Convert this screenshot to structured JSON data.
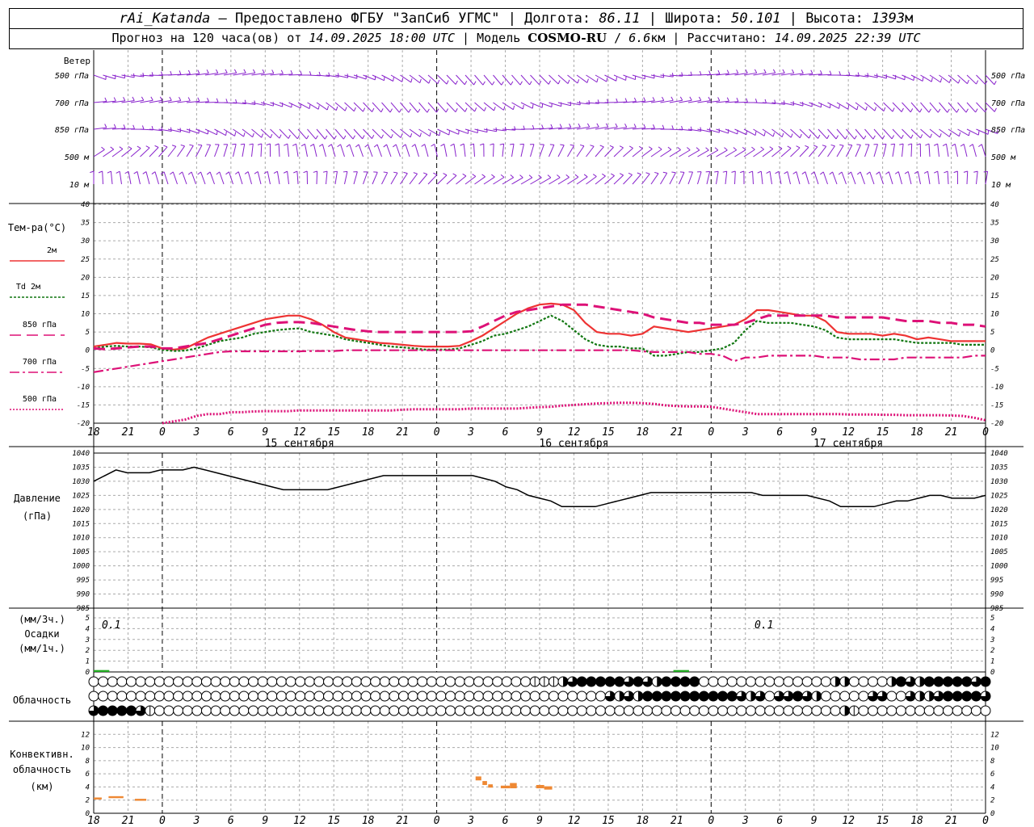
{
  "header": {
    "station": "rAi_Katanda",
    "provider": "Предоставлено ФГБУ \"ЗапСиб УГМС\"",
    "lon_label": "Долгота:",
    "lon": "86.11",
    "lat_label": "Широта:",
    "lat": "50.101",
    "alt_label": "Высота:",
    "alt": "1393",
    "alt_unit": "м",
    "forecast_label": "Прогноз на 120 часа(ов) от",
    "forecast_from": "14.09.2025 18:00 UTC",
    "model_label": "Модель",
    "model": "COSMO-RU",
    "resolution": "6.6",
    "res_unit": "км",
    "computed_label": "Рассчитано:",
    "computed": "14.09.2025 22:39 UTC"
  },
  "labels": {
    "wind": "Ветер",
    "wind_levels": [
      "500 гПа",
      "700 гПа",
      "850 гПа",
      "500 м",
      "10 м"
    ],
    "temp_title": "Тем-ра(°C)",
    "temp_legend": [
      "2м",
      "Td 2м",
      "850 гПа",
      "700 гПа",
      "500 гПа"
    ],
    "pressure": "Давление",
    "pressure_unit": "(гПа)",
    "precip_unit_top": "(мм/3ч.)",
    "precip": "Осадки",
    "precip_unit_bottom": "(мм/1ч.)",
    "cloud": "Облачность",
    "conv1": "Конвективн.",
    "conv2": "облачность",
    "conv3": "(км)",
    "day_labels": [
      "15 сентября",
      "16 сентября",
      "17 сентября"
    ],
    "precip_annotations": [
      "0.1",
      "0.1"
    ]
  },
  "colors": {
    "t2m": "#ee3333",
    "td2m": "#117711",
    "t850": "#dd1177",
    "t700": "#dd1177",
    "t500": "#dd1177",
    "pressure": "#000000",
    "wind": "#8822cc",
    "precip": "#22aa22",
    "conv": "#ee8833",
    "grid": "#aaaaaa"
  },
  "chart_data": [
    {
      "type": "line",
      "name": "temperature",
      "x_hours": [
        0,
        1,
        2,
        3,
        4,
        5,
        6,
        7,
        8,
        9,
        10,
        11,
        12,
        13,
        14,
        15,
        16,
        17,
        18,
        19,
        20,
        21,
        22,
        23,
        24,
        25,
        26,
        27,
        28,
        29,
        30,
        31,
        32,
        33,
        34,
        35,
        36,
        37,
        38,
        39,
        40,
        41,
        42,
        43,
        44,
        45,
        46,
        47,
        48,
        49,
        50,
        51,
        52,
        53,
        54,
        55,
        56,
        57,
        58,
        59,
        60,
        61,
        62,
        63,
        64,
        65,
        66,
        67,
        68,
        69,
        70,
        71,
        72,
        73,
        74,
        75,
        76,
        77,
        78
      ],
      "x_tick_labels": [
        "18",
        "21",
        "0",
        "3",
        "6",
        "9",
        "12",
        "15",
        "18",
        "21",
        "0",
        "3",
        "6",
        "9",
        "12",
        "15",
        "18",
        "21",
        "0",
        "3",
        "6",
        "9",
        "12",
        "15",
        "18",
        "21",
        "0"
      ],
      "ylim": [
        -20,
        40
      ],
      "yticks": [
        -20,
        -15,
        -10,
        -5,
        0,
        5,
        10,
        15,
        20,
        25,
        30,
        35,
        40
      ],
      "series": [
        {
          "name": "2м",
          "values": [
            1,
            1.5,
            2,
            1.8,
            1.8,
            1.6,
            0.5,
            0.2,
            0.5,
            2,
            3.5,
            4.5,
            5.5,
            6.5,
            7.5,
            8.5,
            9,
            9.5,
            9.5,
            8.5,
            7,
            5,
            3.5,
            3,
            2.5,
            2,
            1.8,
            1.5,
            1.2,
            1,
            1,
            1,
            1.2,
            2.5,
            4,
            6,
            8,
            10,
            11.5,
            12.5,
            12.8,
            12.5,
            11,
            7.5,
            5,
            4.5,
            4.5,
            4,
            4.5,
            6.5,
            6,
            5.5,
            5,
            5.5,
            6,
            6.5,
            7,
            8.5,
            11,
            11,
            10.5,
            10,
            9.5,
            9.5,
            8,
            5,
            4.5,
            4.5,
            4.5,
            4,
            4.5,
            4,
            3,
            3.5,
            3,
            2.5,
            2.5,
            2.5,
            2.5
          ]
        },
        {
          "name": "Td 2м",
          "values": [
            0.5,
            1,
            1.2,
            1,
            1,
            0.8,
            0.1,
            -0.2,
            -0.1,
            0.5,
            1.5,
            2.5,
            3,
            3.5,
            4.5,
            5,
            5.5,
            5.8,
            6,
            5,
            4.5,
            4,
            3,
            2.5,
            2,
            1.5,
            1,
            0.8,
            0.5,
            0.2,
            0.2,
            0.2,
            0.5,
            1.5,
            2.5,
            4,
            4.5,
            5.5,
            6.5,
            8,
            9.5,
            8,
            5.5,
            3,
            1.5,
            1,
            1,
            0.5,
            0.5,
            -1.5,
            -1.5,
            -1,
            -0.5,
            -0.5,
            0,
            0.5,
            2,
            5.5,
            8,
            7.5,
            7.5,
            7.5,
            7,
            6.5,
            5.5,
            3.5,
            3,
            3,
            3,
            3,
            3,
            2.5,
            2,
            2,
            2,
            2,
            1.5,
            1.5,
            1.5
          ]
        },
        {
          "name": "850 гПа",
          "values": [
            0.5,
            0.3,
            0.5,
            0.8,
            1,
            1,
            0.5,
            0.5,
            1,
            1.5,
            2,
            3,
            4,
            5,
            6,
            7,
            7.5,
            7.7,
            7.7,
            7.5,
            7,
            6.5,
            6,
            5.5,
            5.2,
            5,
            5,
            5,
            5,
            5,
            5,
            5,
            5,
            5.2,
            6.5,
            8,
            9.5,
            10.5,
            11,
            11.5,
            12,
            12.5,
            12.5,
            12.5,
            12,
            11.5,
            11,
            10.5,
            10,
            9,
            8.5,
            8,
            7.5,
            7.5,
            7,
            7,
            7,
            7.5,
            8.5,
            9.5,
            9.5,
            9.5,
            9.5,
            9.5,
            9.5,
            9,
            9,
            9,
            9,
            9,
            8.5,
            8,
            8,
            8,
            7.5,
            7.5,
            7,
            7,
            6.5
          ]
        },
        {
          "name": "700 гПа",
          "values": [
            -6,
            -5.5,
            -5,
            -4.5,
            -4,
            -3.5,
            -3,
            -2.5,
            -2,
            -1.5,
            -1,
            -0.5,
            -0.3,
            -0.3,
            -0.3,
            -0.3,
            -0.3,
            -0.3,
            -0.3,
            -0.2,
            -0.2,
            -0.2,
            0,
            0,
            0,
            0,
            0,
            0,
            0,
            0,
            0,
            0,
            0,
            0,
            0,
            0,
            0,
            0,
            0,
            0,
            0,
            0,
            0,
            0,
            0,
            0,
            0,
            0,
            -0.3,
            -0.5,
            -0.5,
            -0.5,
            -0.5,
            -1,
            -1,
            -1.5,
            -3,
            -2,
            -2,
            -1.5,
            -1.5,
            -1.5,
            -1.5,
            -1.5,
            -2,
            -2,
            -2,
            -2.5,
            -2.5,
            -2.5,
            -2.5,
            -2,
            -2,
            -2,
            -2,
            -2,
            -2,
            -1.5,
            -1.5
          ]
        },
        {
          "name": "500 гПа",
          "values": [
            null,
            null,
            null,
            null,
            null,
            null,
            -20,
            -19.5,
            -19,
            -18,
            -17.5,
            -17.5,
            -17,
            -17,
            -16.8,
            -16.7,
            -16.7,
            -16.7,
            -16.5,
            -16.5,
            -16.5,
            -16.5,
            -16.5,
            -16.5,
            -16.5,
            -16.5,
            -16.5,
            -16.3,
            -16.2,
            -16.2,
            -16.2,
            -16.2,
            -16.2,
            -16,
            -16,
            -16,
            -16,
            -16,
            -15.8,
            -15.6,
            -15.5,
            -15.2,
            -15,
            -14.8,
            -14.6,
            -14.5,
            -14.4,
            -14.4,
            -14.5,
            -14.7,
            -15.1,
            -15.3,
            -15.4,
            -15.4,
            -15.5,
            -16,
            -16.5,
            -17,
            -17.5,
            -17.5,
            -17.5,
            -17.5,
            -17.5,
            -17.5,
            -17.5,
            -17.5,
            -17.6,
            -17.6,
            -17.6,
            -17.7,
            -17.7,
            -17.8,
            -17.8,
            -17.8,
            -17.8,
            -17.9,
            -18,
            -18.5,
            -19.2
          ]
        }
      ]
    },
    {
      "type": "line",
      "name": "pressure",
      "ylim": [
        985,
        1040
      ],
      "yticks": [
        985,
        990,
        995,
        1000,
        1005,
        1010,
        1015,
        1020,
        1025,
        1030,
        1035,
        1040
      ],
      "series": [
        {
          "name": "pressure",
          "values": [
            1030,
            1032,
            1034,
            1033,
            1033,
            1033,
            1034,
            1034,
            1034,
            1035,
            1034,
            1033,
            1032,
            1031,
            1030,
            1029,
            1028,
            1027,
            1027,
            1027,
            1027,
            1027,
            1028,
            1029,
            1030,
            1031,
            1032,
            1032,
            1032,
            1032,
            1032,
            1032,
            1032,
            1032,
            1032,
            1031,
            1030,
            1028,
            1027,
            1025,
            1024,
            1023,
            1021,
            1021,
            1021,
            1021,
            1022,
            1023,
            1024,
            1025,
            1026,
            1026,
            1026,
            1026,
            1026,
            1026,
            1026,
            1026,
            1026,
            1026,
            1025,
            1025,
            1025,
            1025,
            1025,
            1024,
            1023,
            1021,
            1021,
            1021,
            1021,
            1022,
            1023,
            1023,
            1024,
            1025,
            1025,
            1024,
            1024,
            1024,
            1025
          ]
        }
      ]
    },
    {
      "type": "bar",
      "name": "precipitation",
      "ylim": [
        0,
        5
      ],
      "yticks": [
        0,
        1,
        2,
        3,
        4,
        5
      ],
      "series": [
        {
          "name": "precip",
          "values": [
            0.1,
            0,
            0,
            0,
            0,
            0,
            0,
            0,
            0,
            0,
            0,
            0,
            0,
            0,
            0,
            0,
            0,
            0,
            0,
            0,
            0,
            0,
            0,
            0,
            0,
            0,
            0.1,
            0,
            0,
            0,
            0,
            0,
            0,
            0,
            0,
            0,
            0,
            0,
            0,
            0,
            0
          ]
        }
      ]
    },
    {
      "type": "table",
      "name": "cloudiness",
      "rows": [
        [
          0,
          0,
          0,
          0,
          0,
          0,
          0,
          0,
          0,
          0,
          0,
          0,
          0,
          0,
          0,
          0,
          0,
          0,
          0,
          0,
          0,
          0,
          0,
          0,
          0,
          0,
          0,
          0,
          0,
          0,
          0,
          0,
          0,
          0,
          0,
          0,
          0,
          0,
          0,
          0,
          0,
          0,
          0,
          0,
          0,
          0,
          0,
          1,
          1,
          1,
          2,
          3,
          4,
          4,
          4,
          4,
          4,
          3,
          4,
          3,
          2,
          4,
          4,
          4,
          4,
          0,
          0,
          0,
          0,
          0,
          0,
          0,
          0,
          0,
          0,
          0,
          0,
          0,
          0,
          2,
          2,
          0,
          0,
          0,
          0,
          2,
          4,
          3,
          2,
          4,
          4,
          4,
          4,
          4,
          3,
          4
        ],
        [
          0,
          0,
          0,
          0,
          0,
          0,
          0,
          0,
          0,
          0,
          0,
          0,
          0,
          0,
          0,
          0,
          0,
          0,
          0,
          0,
          0,
          0,
          0,
          0,
          0,
          0,
          0,
          0,
          0,
          0,
          0,
          0,
          0,
          0,
          0,
          0,
          0,
          0,
          0,
          0,
          0,
          0,
          0,
          0,
          0,
          0,
          0,
          0,
          0,
          0,
          0,
          0,
          0,
          0,
          0,
          3,
          2,
          3,
          2,
          4,
          4,
          4,
          4,
          4,
          4,
          4,
          4,
          4,
          4,
          3,
          2,
          3,
          0,
          3,
          3,
          4,
          3,
          2,
          0,
          0,
          0,
          0,
          0,
          3,
          3,
          0,
          0,
          3,
          2,
          2,
          3,
          4,
          4,
          4,
          4,
          3
        ],
        [
          3,
          4,
          4,
          4,
          4,
          3,
          1,
          0,
          0,
          0,
          0,
          0,
          0,
          0,
          0,
          0,
          0,
          0,
          0,
          0,
          0,
          0,
          0,
          0,
          0,
          0,
          0,
          0,
          0,
          0,
          0,
          0,
          0,
          0,
          0,
          0,
          0,
          0,
          0,
          0,
          0,
          0,
          0,
          0,
          0,
          0,
          0,
          0,
          0,
          0,
          0,
          0,
          0,
          0,
          0,
          0,
          0,
          0,
          0,
          0,
          0,
          0,
          0,
          0,
          0,
          0,
          0,
          0,
          0,
          0,
          0,
          0,
          0,
          0,
          0,
          0,
          0,
          0,
          0,
          0,
          2,
          1,
          0,
          0,
          0,
          0,
          0,
          0,
          0,
          0,
          0,
          0,
          0,
          0,
          0,
          0
        ]
      ]
    },
    {
      "type": "bar",
      "name": "convective_cloud",
      "ylim": [
        0,
        14
      ],
      "yticks": [
        0,
        2,
        4,
        6,
        8,
        10,
        12
      ],
      "segments": [
        {
          "h0": 0,
          "h1": 0.7,
          "base": 2.1,
          "top": 2.4
        },
        {
          "h0": 1.3,
          "h1": 2.6,
          "base": 2.3,
          "top": 2.6
        },
        {
          "h0": 3.6,
          "h1": 4.6,
          "base": 1.9,
          "top": 2.2
        },
        {
          "h0": 33.4,
          "h1": 33.9,
          "base": 5,
          "top": 5.6
        },
        {
          "h0": 34,
          "h1": 34.4,
          "base": 4.3,
          "top": 4.9
        },
        {
          "h0": 34.5,
          "h1": 34.9,
          "base": 3.9,
          "top": 4.4
        },
        {
          "h0": 35.6,
          "h1": 36.4,
          "base": 3.8,
          "top": 4.2
        },
        {
          "h0": 36.4,
          "h1": 37,
          "base": 3.8,
          "top": 4.6
        },
        {
          "h0": 38.7,
          "h1": 39.4,
          "base": 3.8,
          "top": 4.3
        },
        {
          "h0": 39.4,
          "h1": 40.1,
          "base": 3.6,
          "top": 4.1
        }
      ]
    }
  ]
}
